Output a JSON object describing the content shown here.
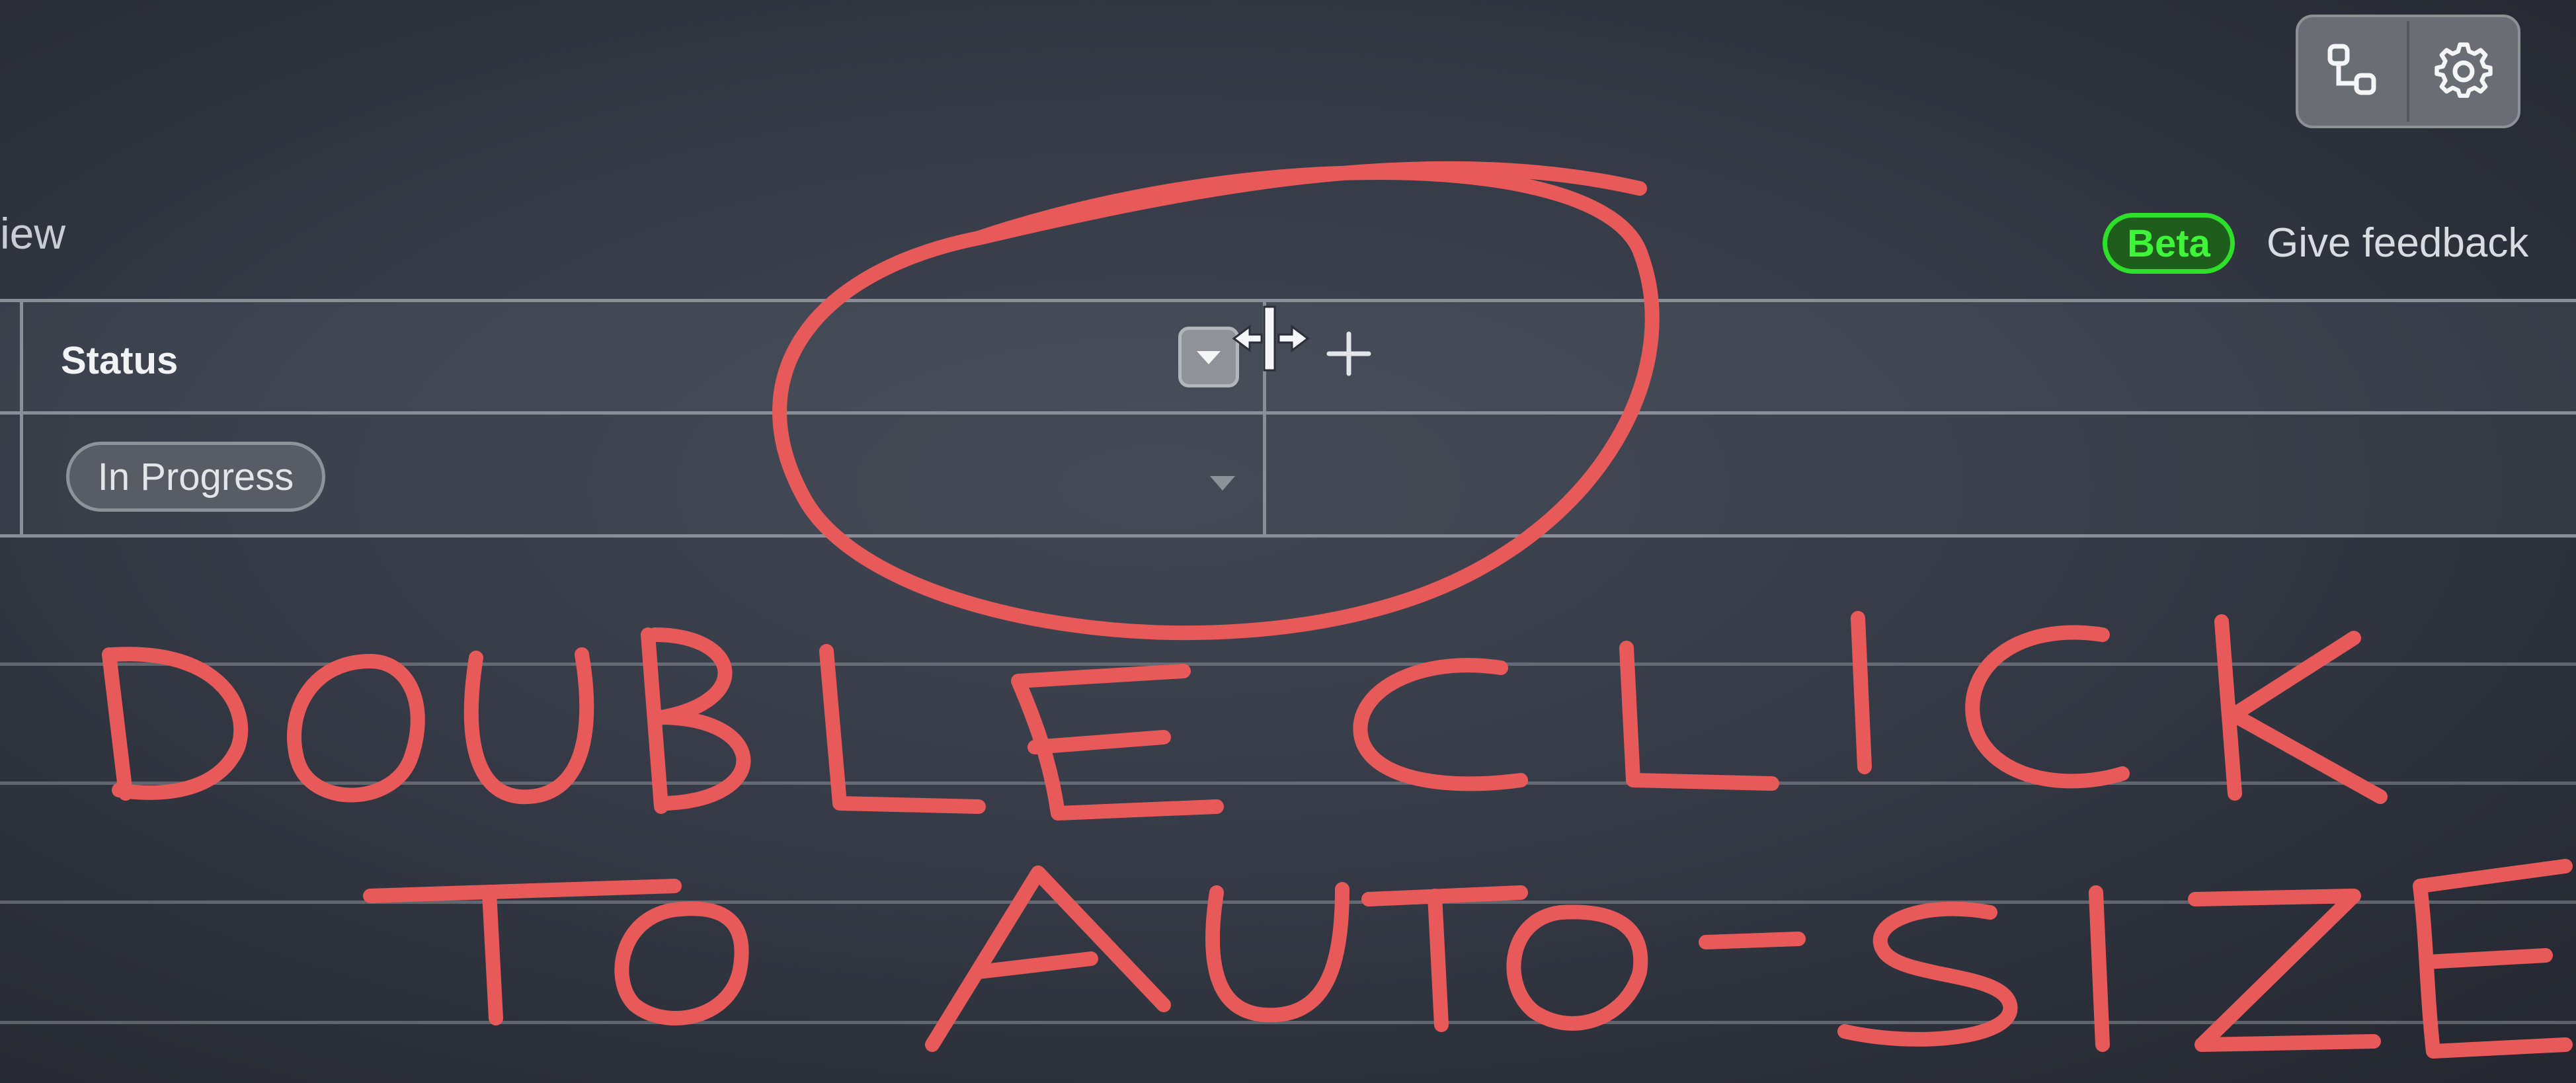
{
  "toolbar": {
    "items": [
      {
        "icon": "workflow-icon"
      },
      {
        "icon": "gear-icon"
      }
    ]
  },
  "header": {
    "view_title": "iew",
    "beta_label": "Beta",
    "feedback_label": "Give feedback"
  },
  "table": {
    "columns": [
      {
        "label": "Status"
      }
    ],
    "rows": [
      {
        "status": "In Progress"
      }
    ]
  },
  "annotation": {
    "color": "#e85a5a",
    "lines": [
      "DOUBLE CLICK",
      "TO AUTO-SIZE"
    ]
  },
  "colors": {
    "accent_beta": "#2fe02a",
    "annotation_red": "#e85a5a"
  }
}
